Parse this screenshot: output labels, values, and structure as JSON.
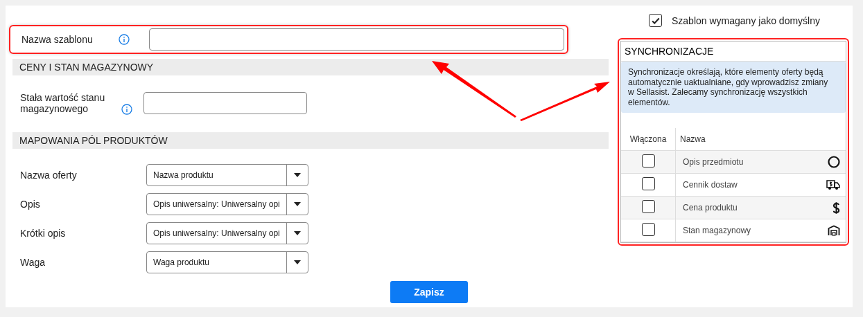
{
  "template_name": {
    "label": "Nazwa szablonu",
    "highlighted": true
  },
  "sections": [
    {
      "title": "CENY I STAN MAGAZYNOWY",
      "fields": [
        {
          "kind": "text",
          "label": "Stała wartość stanu magazynowego",
          "info": true
        }
      ]
    },
    {
      "title": "MAPOWANIA PÓL PRODUKTÓW",
      "fields": [
        {
          "kind": "select",
          "label": "Nazwa oferty",
          "value": "Nazwa produktu"
        },
        {
          "kind": "select",
          "label": "Opis",
          "value": "Opis uniwersalny: Uniwersalny opi"
        },
        {
          "kind": "select",
          "label": "Krótki opis",
          "value": "Opis uniwersalny: Uniwersalny opi"
        },
        {
          "kind": "select",
          "label": "Waga",
          "value": "Waga produktu"
        }
      ]
    }
  ],
  "save_button": "Zapisz",
  "default_checkbox": {
    "label": "Szablon wymagany jako domyślny",
    "checked": true
  },
  "sync": {
    "title": "SYNCHRONIZACJE",
    "highlighted": true,
    "note": "Synchronizacje określają, które elementy oferty będą automatycznie uaktualniane, gdy wprowadzisz zmiany w Sellasist. Zalecamy synchronizację wszystkich elementów.",
    "columns": [
      "Włączona",
      "Nazwa"
    ],
    "rows": [
      {
        "name": "Opis przedmiotu",
        "checked": false
      },
      {
        "name": "Cennik dostaw",
        "checked": false
      },
      {
        "name": "Cena produktu",
        "checked": false
      },
      {
        "name": "Stan magazynowy",
        "checked": false
      }
    ]
  }
}
